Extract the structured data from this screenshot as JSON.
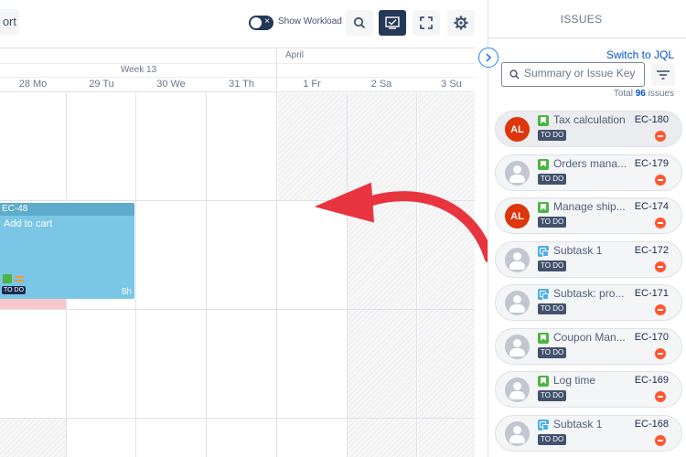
{
  "toolbar": {
    "export_partial": "ort",
    "show_workload_label": "Show Workload",
    "toggle_x": "×"
  },
  "calendar": {
    "month": "April",
    "week": "Week 13",
    "days": [
      "28 Mo",
      "29 Tu",
      "30 We",
      "31 Th",
      "1 Fr",
      "2 Sa",
      "3 Su"
    ],
    "task": {
      "key": "EC-48",
      "title": "Add to cart",
      "status": "TO DO",
      "hours": "8h"
    }
  },
  "panel": {
    "title": "ISSUES",
    "switch_jql": "Switch to JQL",
    "search_placeholder": "Summary or Issue Key",
    "total_prefix": "Total",
    "total_count": "96",
    "total_suffix": "issues",
    "issues": [
      {
        "initials": "AL",
        "avatar": "red",
        "type": "story",
        "summary": "Tax calculation",
        "key": "EC-180",
        "status": "TO DO",
        "active": true
      },
      {
        "initials": "",
        "avatar": "grey",
        "type": "story",
        "summary": "Orders mana...",
        "key": "EC-179",
        "status": "TO DO"
      },
      {
        "initials": "AL",
        "avatar": "red",
        "type": "story",
        "summary": "Manage ship...",
        "key": "EC-174",
        "status": "TO DO"
      },
      {
        "initials": "",
        "avatar": "grey",
        "type": "subtask",
        "summary": "Subtask 1",
        "key": "EC-172",
        "status": "TO DO"
      },
      {
        "initials": "",
        "avatar": "grey",
        "type": "subtask",
        "summary": "Subtask: pro...",
        "key": "EC-171",
        "status": "TO DO"
      },
      {
        "initials": "",
        "avatar": "grey",
        "type": "story",
        "summary": "Coupon Man...",
        "key": "EC-170",
        "status": "TO DO"
      },
      {
        "initials": "",
        "avatar": "grey",
        "type": "story",
        "summary": "Log time",
        "key": "EC-169",
        "status": "TO DO"
      },
      {
        "initials": "",
        "avatar": "grey",
        "type": "subtask",
        "summary": "Subtask 1",
        "key": "EC-168",
        "status": "TO DO"
      }
    ]
  },
  "colors": {
    "accent": "#253858",
    "link": "#0052cc",
    "arrow": "#e8343f",
    "task": "#79c6e6",
    "priority": "#ff5630"
  }
}
